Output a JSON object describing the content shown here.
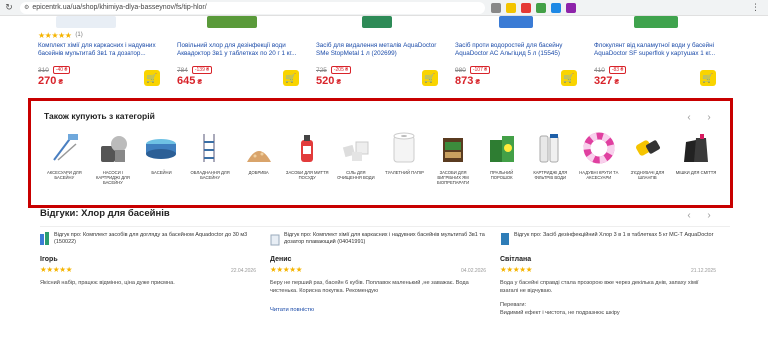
{
  "browser": {
    "url": "epicentrk.ua/ua/shop/khimiya-dlya-basseynov/fs/tip-hlor/"
  },
  "products": [
    {
      "rating_count": "(1)",
      "title": "Комплект хімії для каркасних і надувних басейнів мультитаб 3в1 та дозатор...",
      "old_price": "310",
      "discount": "-40 ₴",
      "price": "270",
      "currency": "₴"
    },
    {
      "rating_count": "",
      "title": "Повільний хлор для дезінфекції води Аквадоктор 3в1 у таблетках по 20 г 1 кг...",
      "old_price": "784",
      "discount": "-139 ₴",
      "price": "645",
      "currency": "₴"
    },
    {
      "rating_count": "",
      "title": "Засіб для видалення металів AquaDoctor SMe StopMetal 1 л (202699)",
      "old_price": "725",
      "discount": "-205 ₴",
      "price": "520",
      "currency": "₴"
    },
    {
      "rating_count": "",
      "title": "Засіб проти водоростей для басейну AquaDoctor AC Альгіцид 5 л (15545)",
      "old_price": "980",
      "discount": "-107 ₴",
      "price": "873",
      "currency": "₴"
    },
    {
      "rating_count": "",
      "title": "Флокулянт від каламутної води у басейні AquaDoctor SF superflok у картушах 1 кг...",
      "old_price": "410",
      "discount": "-83 ₴",
      "price": "327",
      "currency": "₴"
    }
  ],
  "categories_block": {
    "title": "Також купують з категорій",
    "items": [
      {
        "label": "Аксесуари для басейну",
        "icon": "pool-accessories-icon"
      },
      {
        "label": "Насоси і картриджі для басейну",
        "icon": "pool-pump-icon"
      },
      {
        "label": "Басейни",
        "icon": "pool-icon"
      },
      {
        "label": "Обладнання для басейну",
        "icon": "pool-ladder-icon"
      },
      {
        "label": "Добрива",
        "icon": "fertilizer-icon"
      },
      {
        "label": "Засоби для миття посуду",
        "icon": "dish-soap-icon"
      },
      {
        "label": "Сіль для очищення води",
        "icon": "salt-icon"
      },
      {
        "label": "Туалетний папір",
        "icon": "toilet-paper-icon"
      },
      {
        "label": "Засоби для вигрібних ям біопрепарати",
        "icon": "septic-bio-icon"
      },
      {
        "label": "Пральний порошок",
        "icon": "washing-powder-icon"
      },
      {
        "label": "Картриджі для фільтрів води",
        "icon": "water-filter-icon"
      },
      {
        "label": "Надувні круги та аксесуари",
        "icon": "swim-ring-icon"
      },
      {
        "label": "З'єднувачі для шлангів",
        "icon": "hose-connector-icon"
      },
      {
        "label": "Мішки для сміття",
        "icon": "trash-bags-icon"
      }
    ]
  },
  "reviews_block": {
    "title": "Відгуки: Хлор для басейнів",
    "items": [
      {
        "product": "Відгук про: Комплект засобів для догляду за басейном Aquadoctor до 30 м3 (150022)",
        "name": "Ігорь",
        "date": "22.04.2026",
        "text": "Якісний набір, працює відмінно, ціна дуже приємна.",
        "more": ""
      },
      {
        "product": "Відгук про: Комплект хімії для каркасних і надувних басейнів мультитаб 3в1 та дозатор плавающий (04041991)",
        "name": "Денис",
        "date": "04.02.2026",
        "text": "Беру не перший раз, басейн 6 кубів. Поплавок маленький ,не заважає. Вода чистенька. Корисна покупка. Рекомендую",
        "more": "Читати повністю"
      },
      {
        "product": "Відгук про: Засіб дезінфекційний Хлор 3 в 1 в таблетках 5 кг МС-Т AquaDoctor",
        "name": "Світлана",
        "date": "21.12.2025",
        "text": "Вода у басейні справді стала прозорою вже через декілька днів, запаху хімії взагалі не відчуваю.",
        "extra_title": "Переваги:",
        "extra_text": "Видимий ефект і чистота, не подразнює шкіру"
      }
    ]
  }
}
